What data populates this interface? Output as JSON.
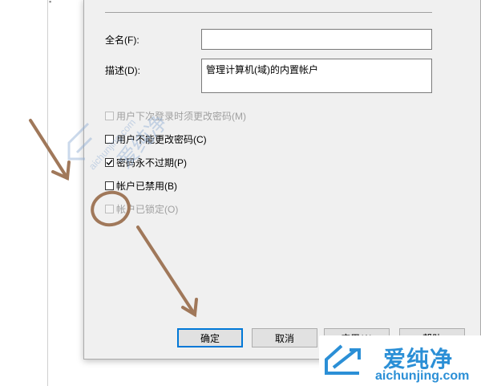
{
  "dialog": {
    "fields": {
      "fullname_label": "全名(F):",
      "fullname_value": "",
      "description_label": "描述(D):",
      "description_value": "管理计算机(域)的内置帐户"
    },
    "checkboxes": [
      {
        "label": "用户下次登录时须更改密码(M)",
        "checked": false,
        "enabled": false
      },
      {
        "label": "用户不能更改密码(C)",
        "checked": false,
        "enabled": true
      },
      {
        "label": "密码永不过期(P)",
        "checked": true,
        "enabled": true
      },
      {
        "label": "帐户已禁用(B)",
        "checked": false,
        "enabled": true
      },
      {
        "label": "帐户已锁定(O)",
        "checked": false,
        "enabled": false
      }
    ],
    "buttons": {
      "ok": "确定",
      "cancel": "取消",
      "apply": "应用(A)",
      "help": "帮助"
    }
  },
  "watermark": {
    "cn": "爱纯净",
    "url": "aichunjing.com"
  },
  "colors": {
    "annotation": "#a0785a",
    "brand": "#2b8fd6",
    "default_button_border": "#0078d7"
  }
}
